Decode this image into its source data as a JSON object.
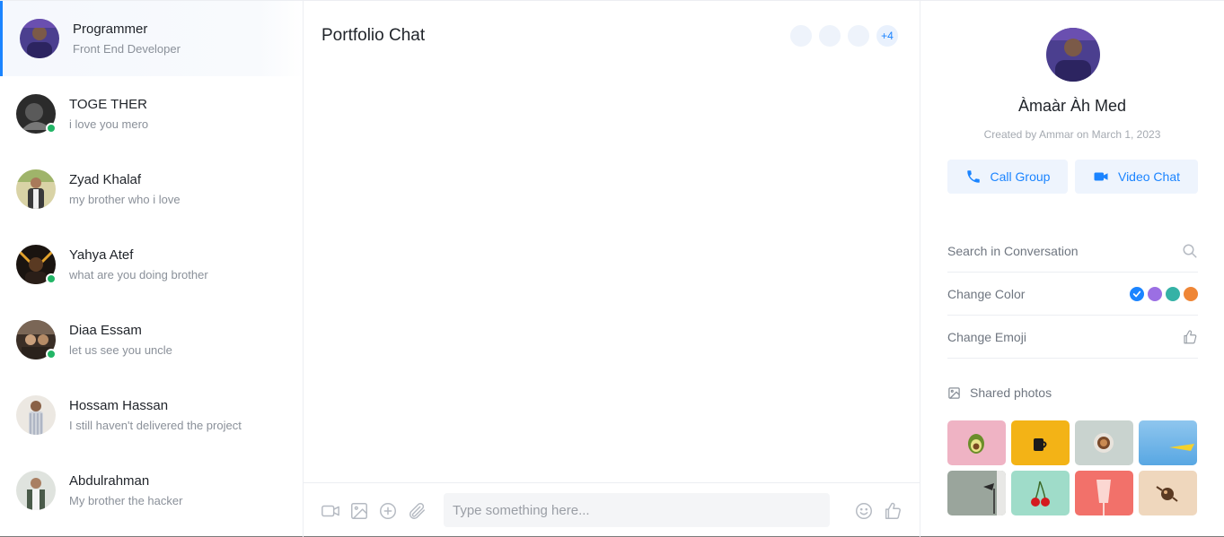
{
  "sidebar": {
    "conversations": [
      {
        "name": "Programmer",
        "message": "Front End Developer",
        "online": false,
        "active": true
      },
      {
        "name": "TOGE THER",
        "message": "i love you mero",
        "online": true,
        "active": false
      },
      {
        "name": "Zyad Khalaf",
        "message": "my brother who i love",
        "online": false,
        "active": false
      },
      {
        "name": "Yahya Atef",
        "message": "what are you doing brother",
        "online": true,
        "active": false
      },
      {
        "name": "Diaa Essam",
        "message": "let us see you uncle",
        "online": true,
        "active": false
      },
      {
        "name": "Hossam Hassan",
        "message": "I still haven't delivered the project",
        "online": false,
        "active": false
      },
      {
        "name": "Abdulrahman",
        "message": "My brother the hacker",
        "online": false,
        "active": false
      }
    ]
  },
  "chat": {
    "title": "Portfolio Chat",
    "members_more": "+4",
    "composer": {
      "placeholder": "Type something here...",
      "icons": [
        "video-camera-icon",
        "image-icon",
        "plus-circle-icon",
        "paperclip-icon",
        "smiley-icon",
        "thumbs-up-icon"
      ]
    }
  },
  "details": {
    "name": "Àmaàr Àh Med",
    "created": "Created by Ammar on March 1, 2023",
    "call_group": "Call Group",
    "video_chat": "Video Chat",
    "search_label": "Search in Conversation",
    "change_color_label": "Change Color",
    "change_emoji_label": "Change Emoji",
    "shared_photos_label": "Shared photos",
    "colors": [
      "#1b84ff",
      "#9b6fe3",
      "#35b2a6",
      "#ef8636"
    ],
    "accent": "#1b84ff"
  }
}
